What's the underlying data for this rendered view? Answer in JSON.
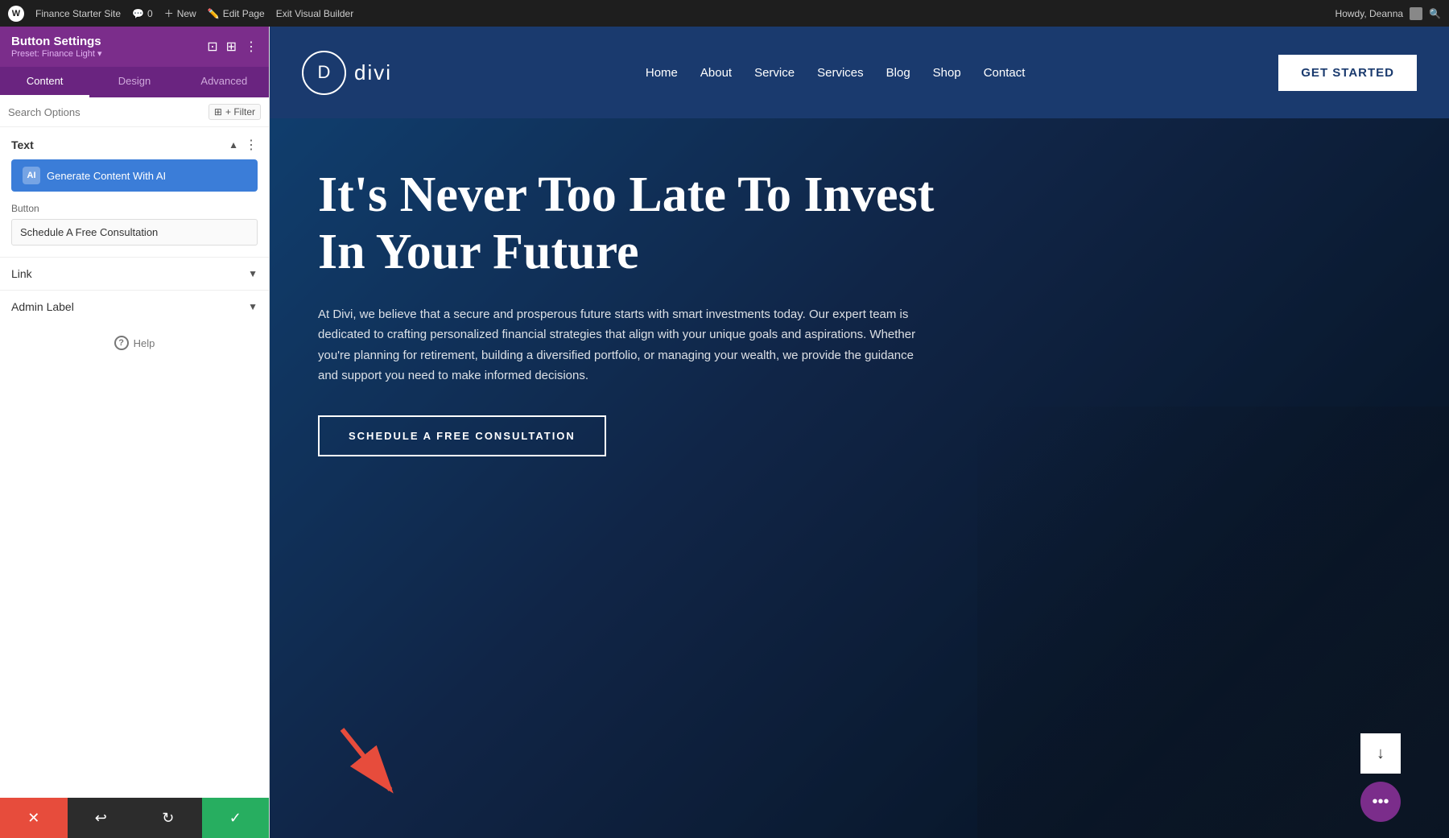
{
  "admin_bar": {
    "site_name": "Finance Starter Site",
    "comments_count": "0",
    "new_label": "New",
    "edit_page_label": "Edit Page",
    "exit_builder_label": "Exit Visual Builder",
    "howdy_label": "Howdy, Deanna"
  },
  "panel": {
    "title": "Button Settings",
    "preset": "Preset: Finance Light ▾",
    "tabs": [
      {
        "id": "content",
        "label": "Content"
      },
      {
        "id": "design",
        "label": "Design"
      },
      {
        "id": "advanced",
        "label": "Advanced"
      }
    ],
    "active_tab": "content",
    "search_placeholder": "Search Options",
    "filter_label": "+ Filter",
    "text_section_title": "Text",
    "ai_button_label": "Generate Content With AI",
    "button_field_label": "Button",
    "button_field_value": "Schedule A Free Consultation",
    "link_section_label": "Link",
    "admin_label_section": "Admin Label",
    "help_label": "Help"
  },
  "bottom_bar": {
    "cancel_icon": "✕",
    "undo_icon": "↩",
    "redo_icon": "↻",
    "save_icon": "✓"
  },
  "site": {
    "logo_letter": "D",
    "logo_name": "divi",
    "nav_items": [
      "Home",
      "About",
      "Service",
      "Services",
      "Blog",
      "Shop",
      "Contact"
    ],
    "cta_button": "GET STARTED",
    "hero_title": "It's Never Too Late To Invest In Your Future",
    "hero_desc": "At Divi, we believe that a secure and prosperous future starts with smart investments today. Our expert team is dedicated to crafting personalized financial strategies that align with your unique goals and aspirations. Whether you're planning for retirement, building a diversified portfolio, or managing your wealth, we provide the guidance and support you need to make informed decisions.",
    "hero_cta": "SCHEDULE A FREE CONSULTATION"
  }
}
